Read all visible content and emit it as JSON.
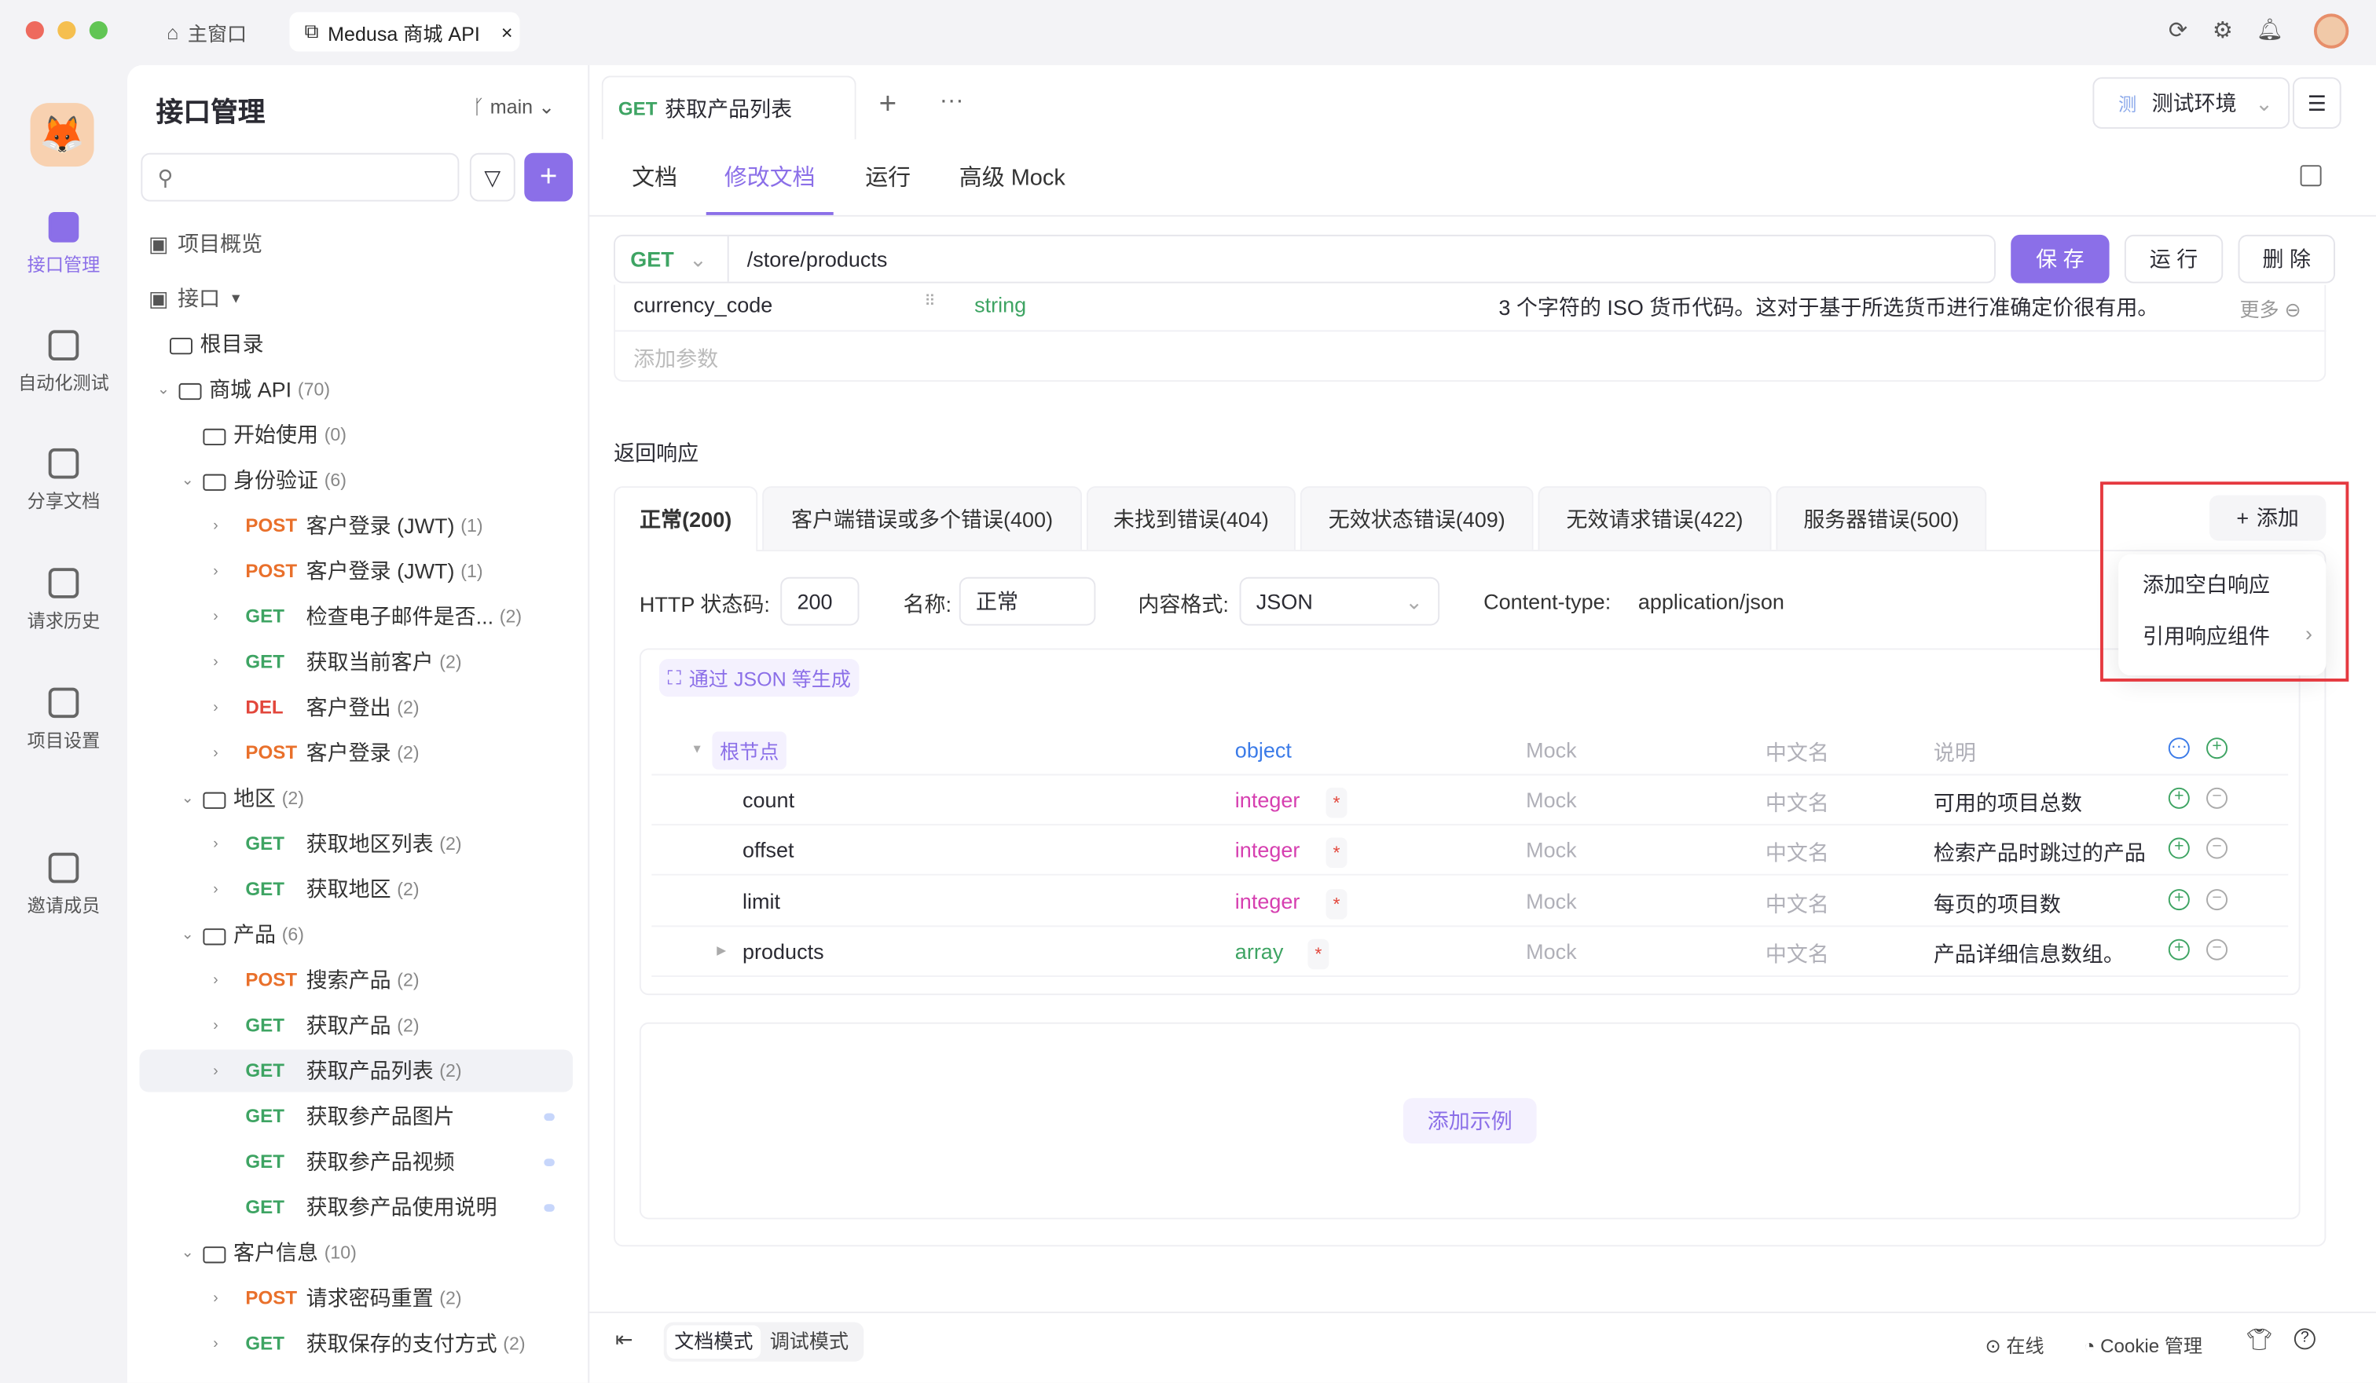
{
  "colors": {
    "accent": "#8b6fe8",
    "get": "#3ea463",
    "post": "#e9702b",
    "del": "#e2473c",
    "highlight": "#e5393f"
  },
  "titlebar": {
    "home_tab": "主窗口",
    "active_tab": "Medusa 商城 API",
    "icons": [
      "refresh-icon",
      "settings-icon",
      "bell-icon",
      "avatar"
    ]
  },
  "rail": [
    {
      "label": "接口管理",
      "icon": "api-icon",
      "active": true
    },
    {
      "label": "自动化测试",
      "icon": "automation-icon"
    },
    {
      "label": "分享文档",
      "icon": "share-doc-icon"
    },
    {
      "label": "请求历史",
      "icon": "history-icon"
    },
    {
      "label": "项目设置",
      "icon": "project-settings-icon"
    },
    {
      "label": "邀请成员",
      "icon": "invite-member-icon"
    }
  ],
  "sidebar": {
    "title": "接口管理",
    "branch": "main",
    "search_placeholder": "",
    "overview": "项目概览",
    "api_root": "接口",
    "tree": [
      {
        "type": "folder",
        "label": "根目录",
        "depth": 0
      },
      {
        "type": "folder",
        "label": "商城 API",
        "count": "(70)",
        "depth": 1,
        "open": true
      },
      {
        "type": "folder",
        "label": "开始使用",
        "count": "(0)",
        "depth": 2
      },
      {
        "type": "folder",
        "label": "身份验证",
        "count": "(6)",
        "depth": 2,
        "open": true
      },
      {
        "type": "api",
        "method": "POST",
        "label": "客户登录 (JWT)",
        "count": "(1)"
      },
      {
        "type": "api",
        "method": "POST",
        "label": "客户登录 (JWT)",
        "count": "(1)"
      },
      {
        "type": "api",
        "method": "GET",
        "label": "检查电子邮件是否...",
        "count": "(2)"
      },
      {
        "type": "api",
        "method": "GET",
        "label": "获取当前客户",
        "count": "(2)"
      },
      {
        "type": "api",
        "method": "DEL",
        "label": "客户登出",
        "count": "(2)"
      },
      {
        "type": "api",
        "method": "POST",
        "label": "客户登录",
        "count": "(2)"
      },
      {
        "type": "folder",
        "label": "地区",
        "count": "(2)",
        "depth": 2,
        "open": true
      },
      {
        "type": "api",
        "method": "GET",
        "label": "获取地区列表",
        "count": "(2)"
      },
      {
        "type": "api",
        "method": "GET",
        "label": "获取地区",
        "count": "(2)"
      },
      {
        "type": "folder",
        "label": "产品",
        "count": "(6)",
        "depth": 2,
        "open": true
      },
      {
        "type": "api",
        "method": "POST",
        "label": "搜索产品",
        "count": "(2)"
      },
      {
        "type": "api",
        "method": "GET",
        "label": "获取产品",
        "count": "(2)"
      },
      {
        "type": "api",
        "method": "GET",
        "label": "获取产品列表",
        "count": "(2)",
        "selected": true
      },
      {
        "type": "case",
        "method": "GET",
        "label": "获取参产品图片"
      },
      {
        "type": "case",
        "method": "GET",
        "label": "获取参产品视频"
      },
      {
        "type": "case",
        "method": "GET",
        "label": "获取参产品使用说明"
      },
      {
        "type": "folder",
        "label": "客户信息",
        "count": "(10)",
        "depth": 2,
        "open": true
      },
      {
        "type": "api",
        "method": "POST",
        "label": "请求密码重置",
        "count": "(2)"
      },
      {
        "type": "api",
        "method": "GET",
        "label": "获取保存的支付方式",
        "count": "(2)"
      }
    ]
  },
  "main": {
    "tab": {
      "method": "GET",
      "label": "获取产品列表"
    },
    "env": {
      "badge": "测",
      "label": "测试环境"
    },
    "subtabs": [
      "文档",
      "修改文档",
      "运行",
      "高级 Mock"
    ],
    "active_subtab": 1,
    "request": {
      "method": "GET",
      "path": "/store/products",
      "save": "保 存",
      "run": "运 行",
      "delete": "删 除"
    },
    "param": {
      "name": "currency_code",
      "type": "string",
      "desc": "3 个字符的 ISO 货币代码。这对于基于所选货币进行准确定价很有用。",
      "more": "更多"
    },
    "add_param": "添加参数",
    "response_title": "返回响应",
    "response_tabs": [
      "正常(200)",
      "客户端错误或多个错误(400)",
      "未找到错误(404)",
      "无效状态错误(409)",
      "无效请求错误(422)",
      "服务器错误(500)"
    ],
    "add_button": "添加",
    "add_menu": [
      "添加空白响应",
      "引用响应组件"
    ],
    "form": {
      "status_label": "HTTP 状态码:",
      "status": "200",
      "name_label": "名称:",
      "name": "正常",
      "format_label": "内容格式:",
      "format": "JSON",
      "ct_label": "Content-type:",
      "ct": "application/json"
    },
    "gen_button": "通过 JSON 等生成",
    "schema": {
      "root": {
        "name": "根节点",
        "type": "object",
        "mock": "Mock",
        "cn": "中文名",
        "desc": "说明"
      },
      "rows": [
        {
          "name": "count",
          "type": "integer",
          "required": true,
          "mock": "Mock",
          "cn": "中文名",
          "desc": "可用的项目总数"
        },
        {
          "name": "offset",
          "type": "integer",
          "required": true,
          "mock": "Mock",
          "cn": "中文名",
          "desc": "检索产品时跳过的产品"
        },
        {
          "name": "limit",
          "type": "integer",
          "required": true,
          "mock": "Mock",
          "cn": "中文名",
          "desc": "每页的项目数"
        },
        {
          "name": "products",
          "type": "array",
          "required": true,
          "mock": "Mock",
          "cn": "中文名",
          "desc": "产品详细信息数组。"
        }
      ]
    },
    "add_example": "添加示例"
  },
  "footer": {
    "doc_mode": "文档模式",
    "debug_mode": "调试模式",
    "online": "在线",
    "cookie": "Cookie 管理"
  }
}
